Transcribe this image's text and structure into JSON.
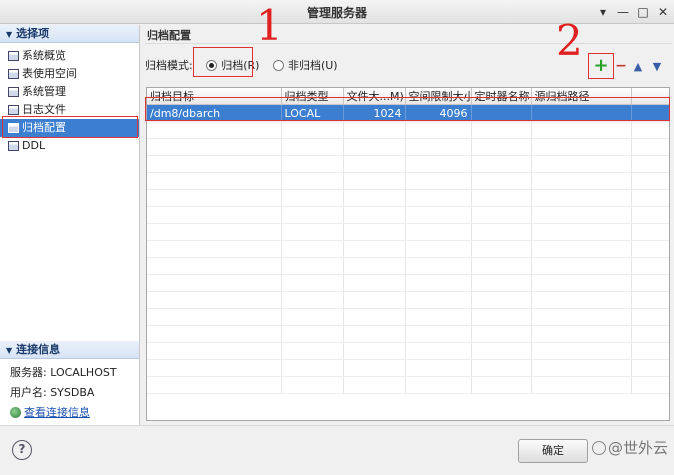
{
  "window": {
    "title": "管理服务器",
    "controls": [
      "▾",
      "—",
      "□",
      "✕"
    ]
  },
  "sidebar": {
    "header": "选择项",
    "items": [
      {
        "label": "系统概览"
      },
      {
        "label": "表使用空间"
      },
      {
        "label": "系统管理"
      },
      {
        "label": "日志文件"
      },
      {
        "label": "归档配置",
        "selected": true
      },
      {
        "label": "DDL"
      }
    ],
    "connection": {
      "header": "连接信息",
      "server": "服务器: LOCALHOST",
      "user": "用户名: SYSDBA",
      "link": "查看连接信息"
    }
  },
  "main": {
    "title": "归档配置",
    "mode_label": "归档模式:",
    "radio_archive": "归档(R)",
    "radio_noarchive": "非归档(U)",
    "archive_selected": true,
    "toolbar": {
      "add": "+",
      "remove": "−",
      "up": "▲",
      "down": "▼"
    },
    "table": {
      "columns": [
        "归档目标",
        "归档类型",
        "文件大...M)",
        "空间限制大小",
        "定时器名称",
        "源归档路径"
      ],
      "rows": [
        [
          "/dm8/dbarch",
          "LOCAL",
          "1024",
          "4096",
          "",
          ""
        ]
      ]
    }
  },
  "annotations": {
    "one": "1",
    "two": "2"
  },
  "footer": {
    "help": "?",
    "ok": "确定",
    "watermark": "@世外云"
  },
  "colors": {
    "selection": "#3c7fd0",
    "annotation": "#e02020",
    "add_green": "#2aa02a"
  }
}
